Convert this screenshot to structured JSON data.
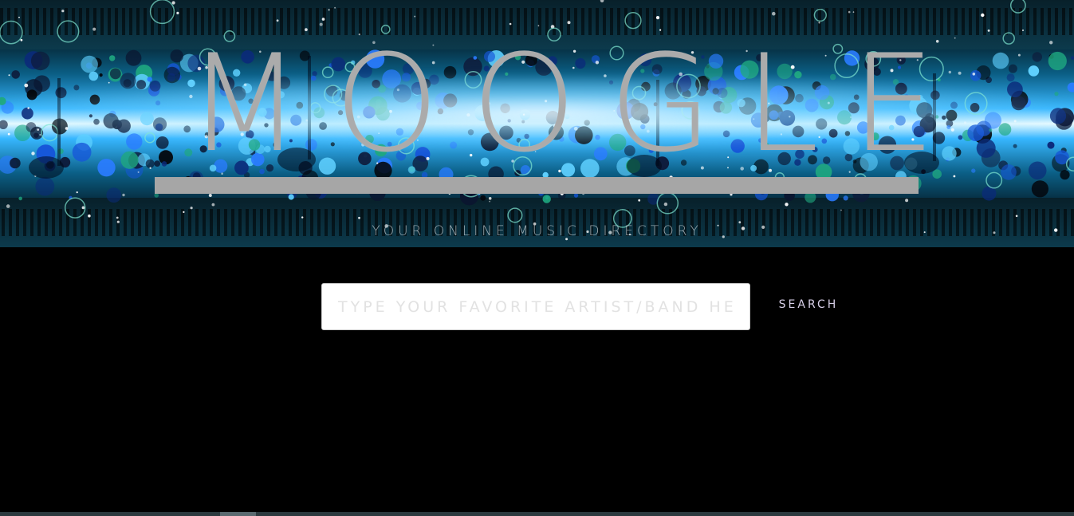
{
  "header": {
    "logo_text": "MOOGLE",
    "tagline": "YOUR ONLINE MUSIC DIRECTORY"
  },
  "search": {
    "placeholder": "TYPE YOUR FAVORITE ARTIST/BAND HERE",
    "value": "",
    "button_label": "SEARCH"
  },
  "colors": {
    "background": "#000000",
    "logo": "#ababab",
    "logo_bar": "#a6a6a6",
    "banner_glow": "#37b7ff",
    "input_background": "#ffffff",
    "button_text": "#d8d0e8"
  }
}
